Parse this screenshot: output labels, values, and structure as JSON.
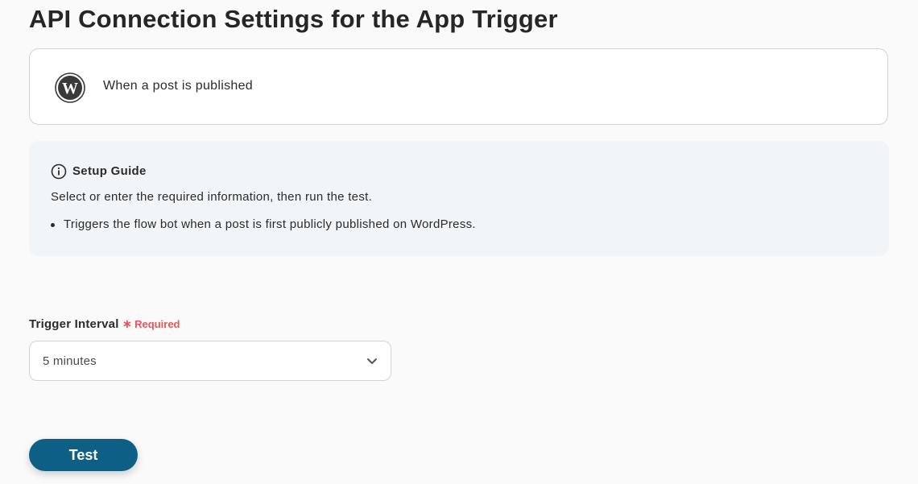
{
  "page": {
    "title": "API Connection Settings for the App Trigger"
  },
  "trigger": {
    "app_icon": "wordpress-icon",
    "label": "When a post is published"
  },
  "setup_guide": {
    "icon": "info-icon",
    "title": "Setup Guide",
    "description": "Select or enter the required information, then run the test.",
    "items": [
      "Triggers the flow bot when a post is first publicly published on WordPress."
    ]
  },
  "trigger_interval": {
    "label": "Trigger Interval",
    "required_text": "Required",
    "required_color": "#e8555a",
    "selected_value": "5 minutes"
  },
  "actions": {
    "test_label": "Test",
    "test_color": "#0d5f86"
  }
}
